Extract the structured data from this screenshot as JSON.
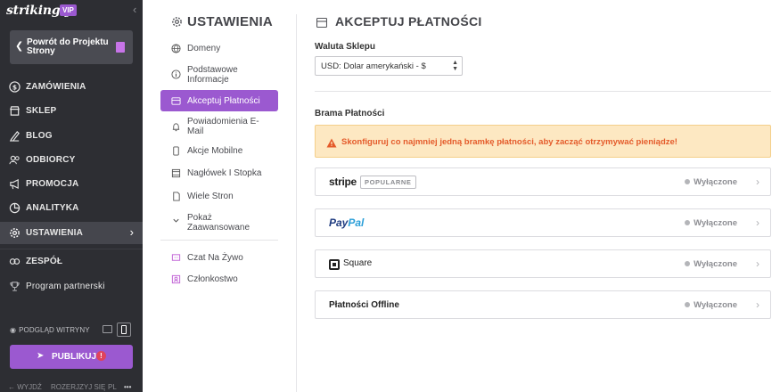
{
  "app": {
    "logo": "strikingly",
    "badge": "VIP",
    "collapse_icon": "chevron-left-icon"
  },
  "sidebar": {
    "back_button": {
      "label": "Powrót do Projektu Strony",
      "icon": "chevron-left-icon",
      "project_icon": "page-icon"
    },
    "items": [
      {
        "label": "ZAMÓWIENIA",
        "icon": "dollar-circle-icon"
      },
      {
        "label": "SKLEP",
        "icon": "store-icon"
      },
      {
        "label": "BLOG",
        "icon": "pen-icon"
      },
      {
        "label": "ODBIORCY",
        "icon": "users-icon"
      },
      {
        "label": "PROMOCJA",
        "icon": "megaphone-icon"
      },
      {
        "label": "ANALITYKA",
        "icon": "chart-pie-icon"
      },
      {
        "label": "USTAWIENIA",
        "icon": "gear-icon",
        "active": true
      }
    ],
    "extra_items": [
      {
        "label": "ZESPÓŁ",
        "icon": "team-icon"
      },
      {
        "label": "Program partnerski",
        "icon": "trophy-icon"
      }
    ],
    "preview_label": "PODGLĄD WITRYNY",
    "publish_label": "PUBLIKUJ",
    "publish_badge": "!",
    "footer": {
      "logout": "← WYJDŹ",
      "expand": "ROZERJZYJ SIĘ",
      "lang": "PL",
      "more": "•••"
    }
  },
  "subnav": {
    "title": "USTAWIENIA",
    "items": [
      {
        "label": "Domeny",
        "icon": "globe-icon"
      },
      {
        "label": "Podstawowe Informacje",
        "icon": "info-icon"
      },
      {
        "label": "Akceptuj Płatności",
        "icon": "credit-card-icon",
        "active": true
      },
      {
        "label": "Powiadomienia E-Mail",
        "icon": "bell-icon"
      },
      {
        "label": "Akcje Mobilne",
        "icon": "mobile-icon"
      },
      {
        "label": "Nagłówek I Stopka",
        "icon": "layout-icon"
      },
      {
        "label": "Wiele Stron",
        "icon": "pages-icon"
      },
      {
        "label": "Pokaż Zaawansowane",
        "icon": "chevron-down-icon"
      },
      {
        "label": "Czat Na Żywo",
        "icon": "chat-icon"
      },
      {
        "label": "Członkostwo",
        "icon": "member-icon"
      }
    ]
  },
  "main": {
    "title": "AKCEPTUJ PŁATNOŚCI",
    "currency_label": "Waluta Sklepu",
    "currency_value": "USD: Dolar amerykański - $",
    "gateway_label": "Brama Płatności",
    "warning": "Skonfiguruj co najmniej jedną bramkę płatności, aby zacząć otrzymywać pieniądze!",
    "gateways": [
      {
        "name": "stripe",
        "tag": "POPULARNE",
        "status": "Wyłączone"
      },
      {
        "name_pay": "Pay",
        "name_pal": "Pal",
        "status": "Wyłączone"
      },
      {
        "name": "Square",
        "status": "Wyłączone"
      },
      {
        "name": "Płatności Offline",
        "status": "Wyłączone"
      }
    ]
  },
  "colors": {
    "accent": "#9b59d0",
    "sidebar_bg": "#2d2e33",
    "warning_bg": "#fde8c2",
    "warning_text": "#e45a2a"
  }
}
